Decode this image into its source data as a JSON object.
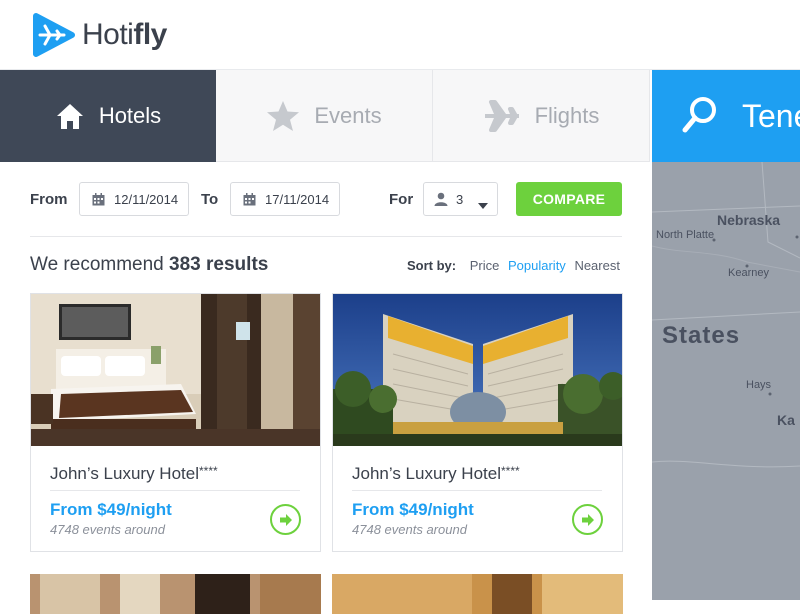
{
  "header": {
    "logo_text_light": "Hoti",
    "logo_text_bold": "fly",
    "logo_color": "#1e9ff2"
  },
  "tabs": [
    {
      "label": "Hotels",
      "icon": "home-icon",
      "active": true
    },
    {
      "label": "Events",
      "icon": "star-icon",
      "active": false
    },
    {
      "label": "Flights",
      "icon": "airplane-icon",
      "active": false
    }
  ],
  "search": {
    "text": "Tene",
    "icon": "search-icon",
    "color": "#1e9ff2"
  },
  "map": {
    "labels": [
      "Nebraska",
      "North Platte",
      "Kearney",
      "States",
      "Hays",
      "Ka"
    ]
  },
  "filters": {
    "from_label": "From",
    "from_value": "12/11/2014",
    "to_label": "To",
    "to_value": "17/11/2014",
    "for_label": "For",
    "guests_value": "3",
    "compare_label": "COMPARE",
    "compare_color": "#6dd13d"
  },
  "results": {
    "prefix": "We recommend",
    "count_text": "383 results"
  },
  "sort": {
    "label": "Sort by:",
    "options": [
      "Price",
      "Popularity",
      "Nearest"
    ],
    "active": "Popularity"
  },
  "cards": [
    {
      "name": "John’s Luxury Hotel",
      "stars": "****",
      "price": "From $49/night",
      "events": "4748 events around",
      "photo": "hotel-room-photo"
    },
    {
      "name": "John’s Luxury Hotel",
      "stars": "****",
      "price": "From $49/night",
      "events": "4748 events around",
      "photo": "hotel-exterior-photo"
    }
  ]
}
